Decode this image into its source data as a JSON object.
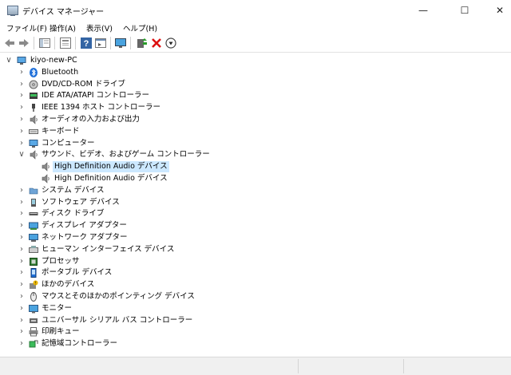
{
  "window": {
    "title": "デバイス マネージャー",
    "minimize": "—",
    "maximize": "☐",
    "close": "✕"
  },
  "menu": [
    "ファイル(F)",
    "操作(A)",
    "表示(V)",
    "ヘルプ(H)"
  ],
  "toolbar": {
    "icons": [
      "back-arrow-icon",
      "forward-arrow-icon",
      "show-hide-console-tree-icon",
      "properties-icon",
      "help-icon",
      "view-icon",
      "monitor-icon",
      "update-driver-icon",
      "uninstall-icon",
      "disable-device-icon"
    ]
  },
  "tree": {
    "root": {
      "label": "kiyo-new-PC",
      "icon": "computer-icon",
      "expanded": true
    },
    "items": [
      {
        "label": "Bluetooth",
        "icon": "bluetooth-icon",
        "expanded": false
      },
      {
        "label": "DVD/CD-ROM ドライブ",
        "icon": "dvd-drive-icon",
        "expanded": false
      },
      {
        "label": "IDE ATA/ATAPI コントローラー",
        "icon": "ide-controller-icon",
        "expanded": false
      },
      {
        "label": "IEEE 1394 ホスト コントローラー",
        "icon": "ieee1394-icon",
        "expanded": false
      },
      {
        "label": "オーディオの入力および出力",
        "icon": "speaker-icon",
        "expanded": false
      },
      {
        "label": "キーボード",
        "icon": "keyboard-icon",
        "expanded": false
      },
      {
        "label": "コンピューター",
        "icon": "computer-icon",
        "expanded": false
      },
      {
        "label": "サウンド、ビデオ、およびゲーム コントローラー",
        "icon": "speaker-icon",
        "expanded": true,
        "children": [
          {
            "label": "High Definition Audio デバイス",
            "icon": "speaker-icon",
            "selected": true
          },
          {
            "label": "High Definition Audio デバイス",
            "icon": "speaker-icon",
            "selected": false
          }
        ]
      },
      {
        "label": "システム デバイス",
        "icon": "folder-device-icon",
        "expanded": false
      },
      {
        "label": "ソフトウェア デバイス",
        "icon": "software-device-icon",
        "expanded": false
      },
      {
        "label": "ディスク ドライブ",
        "icon": "disk-drive-icon",
        "expanded": false
      },
      {
        "label": "ディスプレイ アダプター",
        "icon": "display-adapter-icon",
        "expanded": false
      },
      {
        "label": "ネットワーク アダプター",
        "icon": "network-adapter-icon",
        "expanded": false
      },
      {
        "label": "ヒューマン インターフェイス デバイス",
        "icon": "hid-icon",
        "expanded": false
      },
      {
        "label": "プロセッサ",
        "icon": "processor-icon",
        "expanded": false
      },
      {
        "label": "ポータブル デバイス",
        "icon": "portable-device-icon",
        "expanded": false
      },
      {
        "label": "ほかのデバイス",
        "icon": "other-device-icon",
        "expanded": false
      },
      {
        "label": "マウスとそのほかのポインティング デバイス",
        "icon": "mouse-icon",
        "expanded": false
      },
      {
        "label": "モニター",
        "icon": "monitor-icon",
        "expanded": false
      },
      {
        "label": "ユニバーサル シリアル バス コントローラー",
        "icon": "usb-icon",
        "expanded": false
      },
      {
        "label": "印刷キュー",
        "icon": "printer-icon",
        "expanded": false
      },
      {
        "label": "記憶域コントローラー",
        "icon": "storage-controller-icon",
        "expanded": false
      }
    ]
  },
  "colors": {
    "selection": "#cce8ff",
    "statusbar": "#f0f0f0"
  }
}
